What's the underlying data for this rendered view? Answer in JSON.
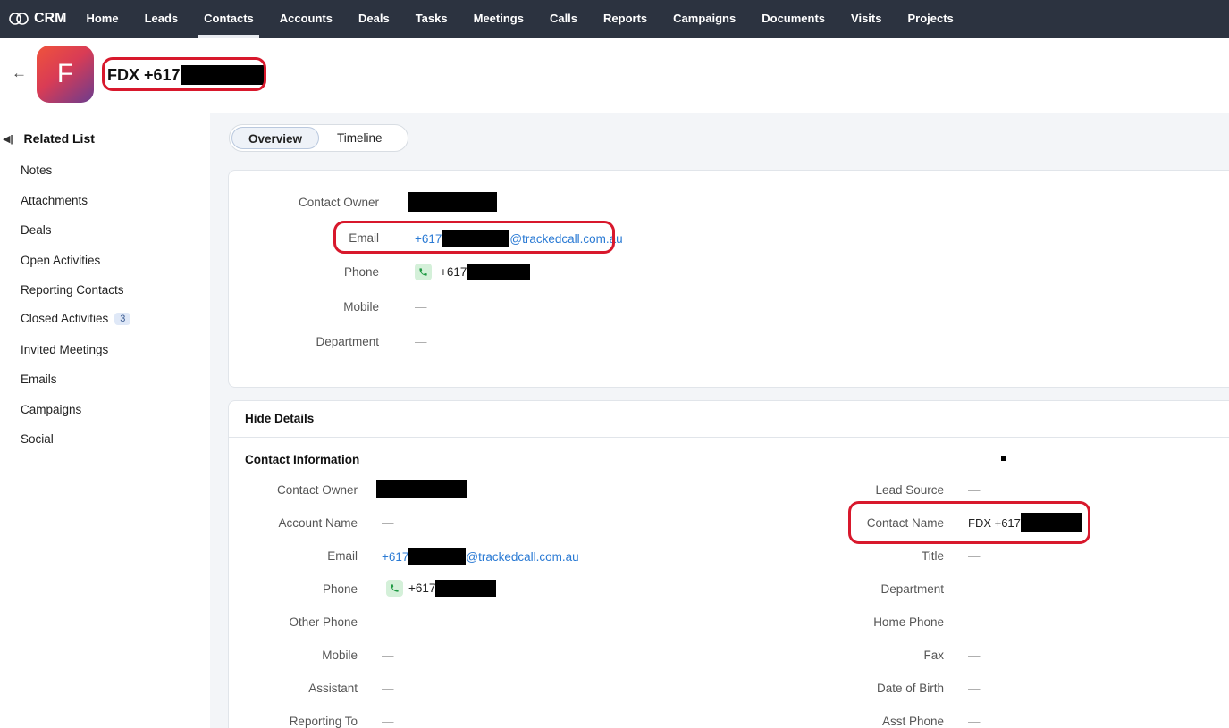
{
  "nav": {
    "brand": "CRM",
    "items": [
      "Home",
      "Leads",
      "Contacts",
      "Accounts",
      "Deals",
      "Tasks",
      "Meetings",
      "Calls",
      "Reports",
      "Campaigns",
      "Documents",
      "Visits",
      "Projects"
    ],
    "active": "Contacts"
  },
  "record": {
    "avatar_letter": "F",
    "title": "FDX +617"
  },
  "sidebar": {
    "heading": "Related List",
    "items": [
      {
        "label": "Notes"
      },
      {
        "label": "Attachments"
      },
      {
        "label": "Deals"
      },
      {
        "label": "Open Activities"
      },
      {
        "label": "Reporting Contacts"
      },
      {
        "label": "Closed Activities",
        "count": "3"
      },
      {
        "label": "Invited Meetings"
      },
      {
        "label": "Emails"
      },
      {
        "label": "Campaigns"
      },
      {
        "label": "Social"
      }
    ]
  },
  "tabs": {
    "overview": "Overview",
    "timeline": "Timeline"
  },
  "overview": {
    "contact_owner_label": "Contact Owner",
    "email_label": "Email",
    "email_prefix": "+617",
    "email_suffix": "@trackedcall.com.au",
    "phone_label": "Phone",
    "phone_value": "+617",
    "mobile_label": "Mobile",
    "mobile_value": "—",
    "department_label": "Department",
    "department_value": "—"
  },
  "details": {
    "toggle_label": "Hide Details",
    "section_title": "Contact Information",
    "left": {
      "contact_owner_label": "Contact Owner",
      "account_name_label": "Account Name",
      "account_name_value": "—",
      "email_label": "Email",
      "email_prefix": "+617",
      "email_suffix": "@trackedcall.com.au",
      "phone_label": "Phone",
      "phone_value": "+617",
      "other_phone_label": "Other Phone",
      "other_phone_value": "—",
      "mobile_label": "Mobile",
      "mobile_value": "—",
      "assistant_label": "Assistant",
      "assistant_value": "—",
      "reporting_to_label": "Reporting To",
      "reporting_to_value": "—"
    },
    "right": {
      "lead_source_label": "Lead Source",
      "lead_source_value": "—",
      "contact_name_label": "Contact Name",
      "contact_name_value": "FDX +617",
      "title_label": "Title",
      "title_value": "—",
      "department_label": "Department",
      "department_value": "—",
      "home_phone_label": "Home Phone",
      "home_phone_value": "—",
      "fax_label": "Fax",
      "fax_value": "—",
      "dob_label": "Date of Birth",
      "dob_value": "—",
      "asst_phone_label": "Asst Phone",
      "asst_phone_value": "—"
    }
  },
  "colors": {
    "nav_bg": "#2c3340",
    "link": "#2a7ad4",
    "annotation": "#d8182c"
  }
}
